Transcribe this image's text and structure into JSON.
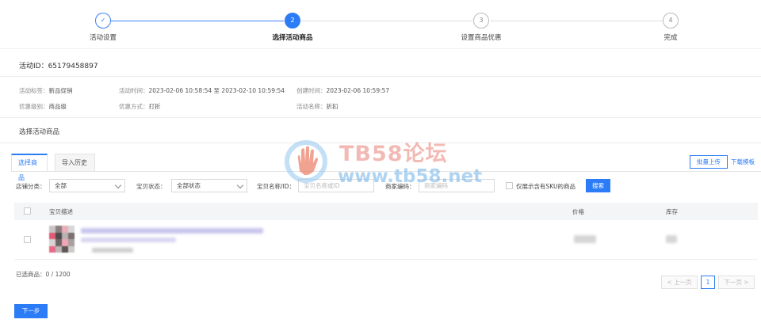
{
  "steps": [
    {
      "label": "活动设置",
      "marker": "✓",
      "state": "done"
    },
    {
      "label": "选择活动商品",
      "marker": "2",
      "state": "active"
    },
    {
      "label": "设置商品优惠",
      "marker": "3",
      "state": "pending"
    },
    {
      "label": "完成",
      "marker": "4",
      "state": "pending"
    }
  ],
  "activity_id": "活动ID：65179458897",
  "info": {
    "tag_key": "活动标签：",
    "tag_val": "新品促销",
    "time_key": "活动时间：",
    "time_val": "2023-02-06 10:58:54 至 2023-02-10 10:59:54",
    "created_key": "创建时间：",
    "created_val": "2023-02-06 10:59:57",
    "level_key": "优惠级别：",
    "level_val": "商品级",
    "method_key": "优惠方式：",
    "method_val": "打折",
    "name_key": "活动名称：",
    "name_val": "折扣"
  },
  "section_title": "选择活动商品",
  "tabs": [
    "选择商品",
    "导入历史"
  ],
  "batch_upload": "批量上传",
  "download_template": "下载模板",
  "filters": {
    "category_label": "店铺分类：",
    "category_value": "全部",
    "status_label": "宝贝状态：",
    "status_value": "全部状态",
    "name_label": "宝贝名称/ID：",
    "name_placeholder": "宝贝名称或ID",
    "code_label": "商家编码：",
    "code_placeholder": "商家编码",
    "sku_only_label": "仅展示含有SKU的商品",
    "search_button": "搜索"
  },
  "table": {
    "headers": [
      "宝贝描述",
      "价格",
      "库存"
    ]
  },
  "selected_count": "已选商品：0 / 1200",
  "pager": {
    "prev": "< 上一页",
    "page": "1",
    "next": "下一页 >"
  },
  "next_button": "下一步",
  "watermark": {
    "title": "TB58论坛",
    "url": "www.tb58.net"
  },
  "colors": {
    "primary": "#2b7cf6",
    "watermark_red": "#e8837a",
    "watermark_blue": "#6fb2e8"
  }
}
